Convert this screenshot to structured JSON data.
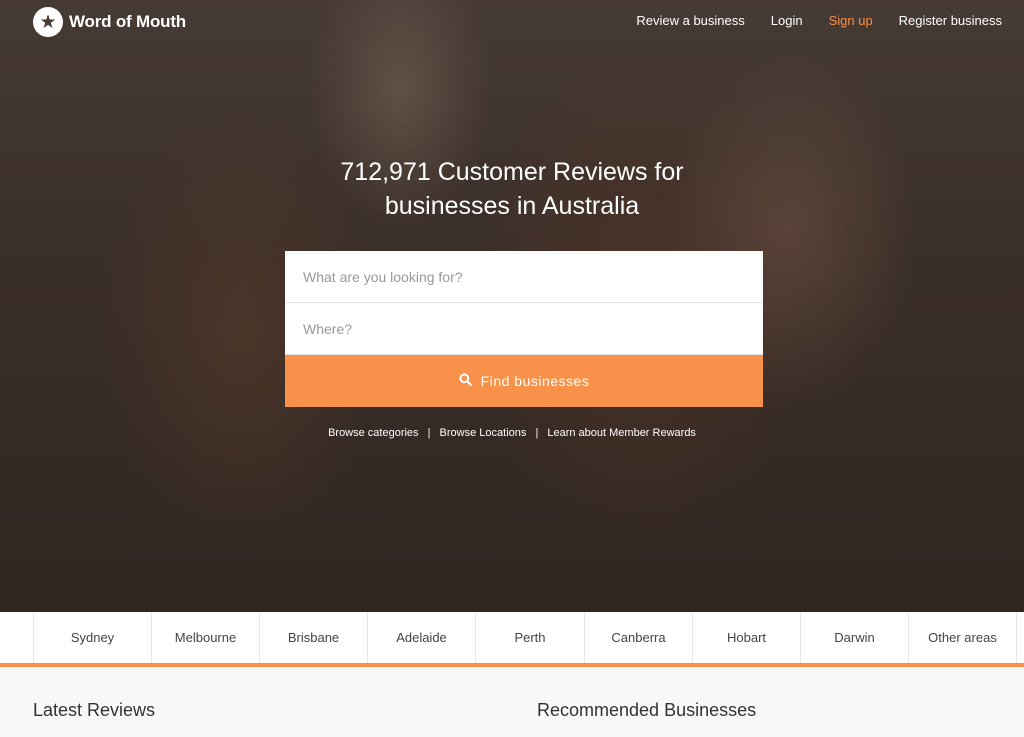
{
  "brand": {
    "name": "Word of Mouth",
    "icon": "star-icon"
  },
  "nav": {
    "review": "Review a business",
    "login": "Login",
    "signup": "Sign up",
    "register": "Register business"
  },
  "hero": {
    "headline_line1": "712,971 Customer Reviews for",
    "headline_line2": "businesses in Australia"
  },
  "search": {
    "what_placeholder": "What are you looking for?",
    "where_placeholder": "Where?",
    "button_label": "Find businesses",
    "button_icon": "search-icon"
  },
  "sublinks": {
    "categories": "Browse categories",
    "locations": "Browse Locations",
    "rewards": "Learn about Member Rewards",
    "separator": "|"
  },
  "cities": [
    "Sydney",
    "Melbourne",
    "Brisbane",
    "Adelaide",
    "Perth",
    "Canberra",
    "Hobart",
    "Darwin",
    "Other areas"
  ],
  "sections": {
    "latest": "Latest Reviews",
    "recommended": "Recommended Businesses"
  },
  "colors": {
    "accent": "#f8924b",
    "signup": "#f7904a"
  }
}
